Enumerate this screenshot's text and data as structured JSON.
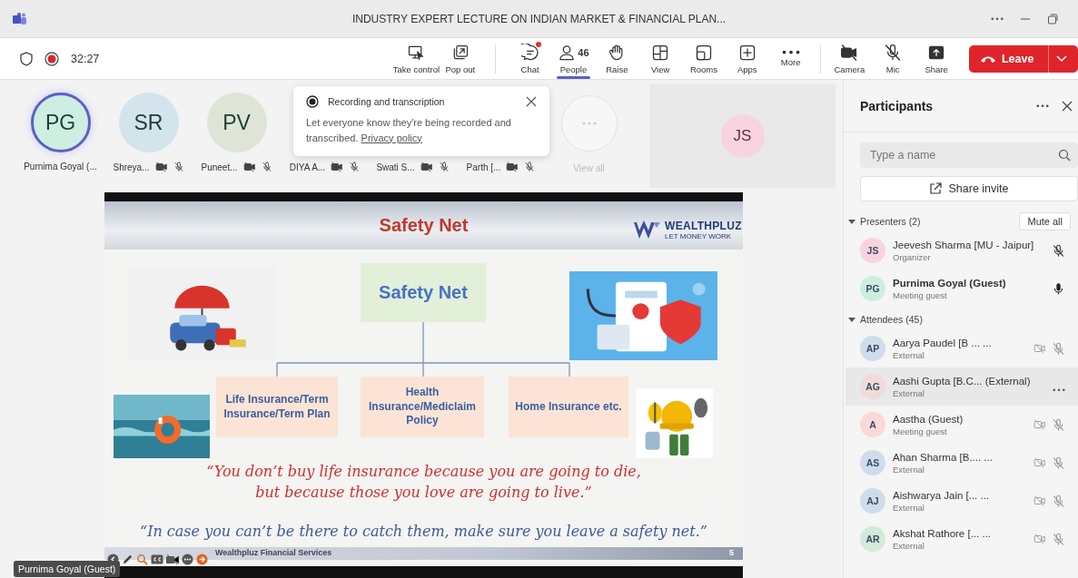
{
  "window": {
    "title": "INDUSTRY EXPERT LECTURE ON INDIAN MARKET & FINANCIAL PLAN..."
  },
  "meeting": {
    "timer": "32:27",
    "recording": true
  },
  "toolbar": [
    {
      "kind": "take-control",
      "label": "Take control",
      "selected": false,
      "unread": false
    },
    {
      "kind": "pop-out",
      "label": "Pop out",
      "selected": false,
      "unread": false
    },
    {
      "kind": "chat",
      "label": "Chat",
      "selected": false,
      "unread": true
    },
    {
      "kind": "people",
      "label": "People",
      "count": "46",
      "selected": true,
      "unread": false
    },
    {
      "kind": "raise",
      "label": "Raise",
      "selected": false,
      "unread": false
    },
    {
      "kind": "view",
      "label": "View",
      "selected": false,
      "unread": false
    },
    {
      "kind": "rooms",
      "label": "Rooms",
      "selected": false,
      "unread": false
    },
    {
      "kind": "apps",
      "label": "Apps",
      "selected": false,
      "unread": false
    },
    {
      "kind": "more",
      "label": "More",
      "selected": false,
      "unread": false
    }
  ],
  "devices": [
    {
      "kind": "camera",
      "label": "Camera",
      "off": true
    },
    {
      "kind": "mic",
      "label": "Mic",
      "off": true
    },
    {
      "kind": "share",
      "label": "Share",
      "off": false
    }
  ],
  "leave": {
    "label": "Leave"
  },
  "gallery": {
    "tiles": [
      {
        "initials": "PG",
        "name": "Purnima Goyal (...",
        "color": "#cdeee0",
        "speaking": true,
        "camera_off": false,
        "mic_off": false
      },
      {
        "initials": "SR",
        "name": "Shreya...",
        "color": "#d3e4ec",
        "speaking": false,
        "camera_off": true,
        "mic_off": true
      },
      {
        "initials": "PV",
        "name": "Puneet...",
        "color": "#dfe5d6",
        "speaking": false,
        "camera_off": true,
        "mic_off": true
      },
      {
        "name": "DIYA A...",
        "camera_off": true,
        "mic_off": true
      },
      {
        "name": "Swati S...",
        "camera_off": true,
        "mic_off": true
      },
      {
        "name": "Parth [...",
        "camera_off": true,
        "mic_off": true
      }
    ],
    "view_all": "View all",
    "spotlight": {
      "initials": "JS",
      "color": "#f9d3df"
    }
  },
  "recording_notice": {
    "title": "Recording and transcription",
    "text": "Let everyone know they're being recorded and transcribed.",
    "link": "Privacy policy"
  },
  "slide": {
    "title": "Safety Net",
    "logo": "WEALTHPLUZ",
    "tagline": "LET MONEY WORK",
    "center": "Safety Net",
    "boxes": [
      "Life Insurance/Term Insurance/Term Plan",
      "Health Insurance/Mediclaim Policy",
      "Home Insurance etc."
    ],
    "quotes": [
      {
        "lines": [
          "“You don’t buy life insurance because you are going to die,",
          "but because those you love are going to live.”"
        ],
        "color": "#d0312d"
      },
      {
        "lines": [
          "“In case you can’t be there to catch them, make sure you leave a safety net.”"
        ],
        "color": "#3c5a99"
      }
    ],
    "footer": "Wealthpluz Financial Services",
    "page": "5"
  },
  "presenter_label": "Purnima Goyal (Guest)",
  "participants_panel": {
    "title": "Participants",
    "search_placeholder": "Type a name",
    "share_invite": "Share invite",
    "sections": [
      {
        "kind": "presenters",
        "title": "Presenters (2)",
        "expanded": true,
        "action": "Mute all",
        "people": [
          {
            "initials": "JS",
            "name": "Jeevesh Sharma [MU - Jaipur]",
            "role": "Organizer",
            "color": "#f9d3df",
            "speaking": false,
            "mic_muted": true,
            "selected": false
          },
          {
            "initials": "PG",
            "name": "Purnima Goyal (Guest)",
            "role": "Meeting guest",
            "color": "#cdeee0",
            "speaking": true,
            "mic_muted": false,
            "selected": false
          }
        ]
      },
      {
        "kind": "attendees",
        "title": "Attendees (45)",
        "expanded": true,
        "people": [
          {
            "initials": "AP",
            "name": "Aarya Paudel [B ... ...",
            "role": "External",
            "color": "#cfdcec",
            "speaking": false,
            "mic_muted": true,
            "selected": false
          },
          {
            "initials": "AG",
            "name": "Aashi Gupta [B.C... (External)",
            "role": "External",
            "color": "#efdcd8",
            "speaking": false,
            "selected": true
          },
          {
            "initials": "A",
            "name": "Aastha (Guest)",
            "role": "Meeting guest",
            "color": "#fbd9d6",
            "speaking": false,
            "mic_muted": true,
            "selected": false
          },
          {
            "initials": "AS",
            "name": "Ahan Sharma [B.... ...",
            "role": "External",
            "color": "#cfdcec",
            "speaking": false,
            "mic_muted": true,
            "selected": false
          },
          {
            "initials": "AJ",
            "name": "Aishwarya Jain [... ...",
            "role": "External",
            "color": "#cfdcec",
            "speaking": false,
            "mic_muted": true,
            "selected": false
          },
          {
            "initials": "AR",
            "name": "Akshat Rathore [... ...",
            "role": "External",
            "color": "#d2ead9",
            "speaking": false,
            "mic_muted": true,
            "selected": false
          }
        ]
      }
    ]
  }
}
